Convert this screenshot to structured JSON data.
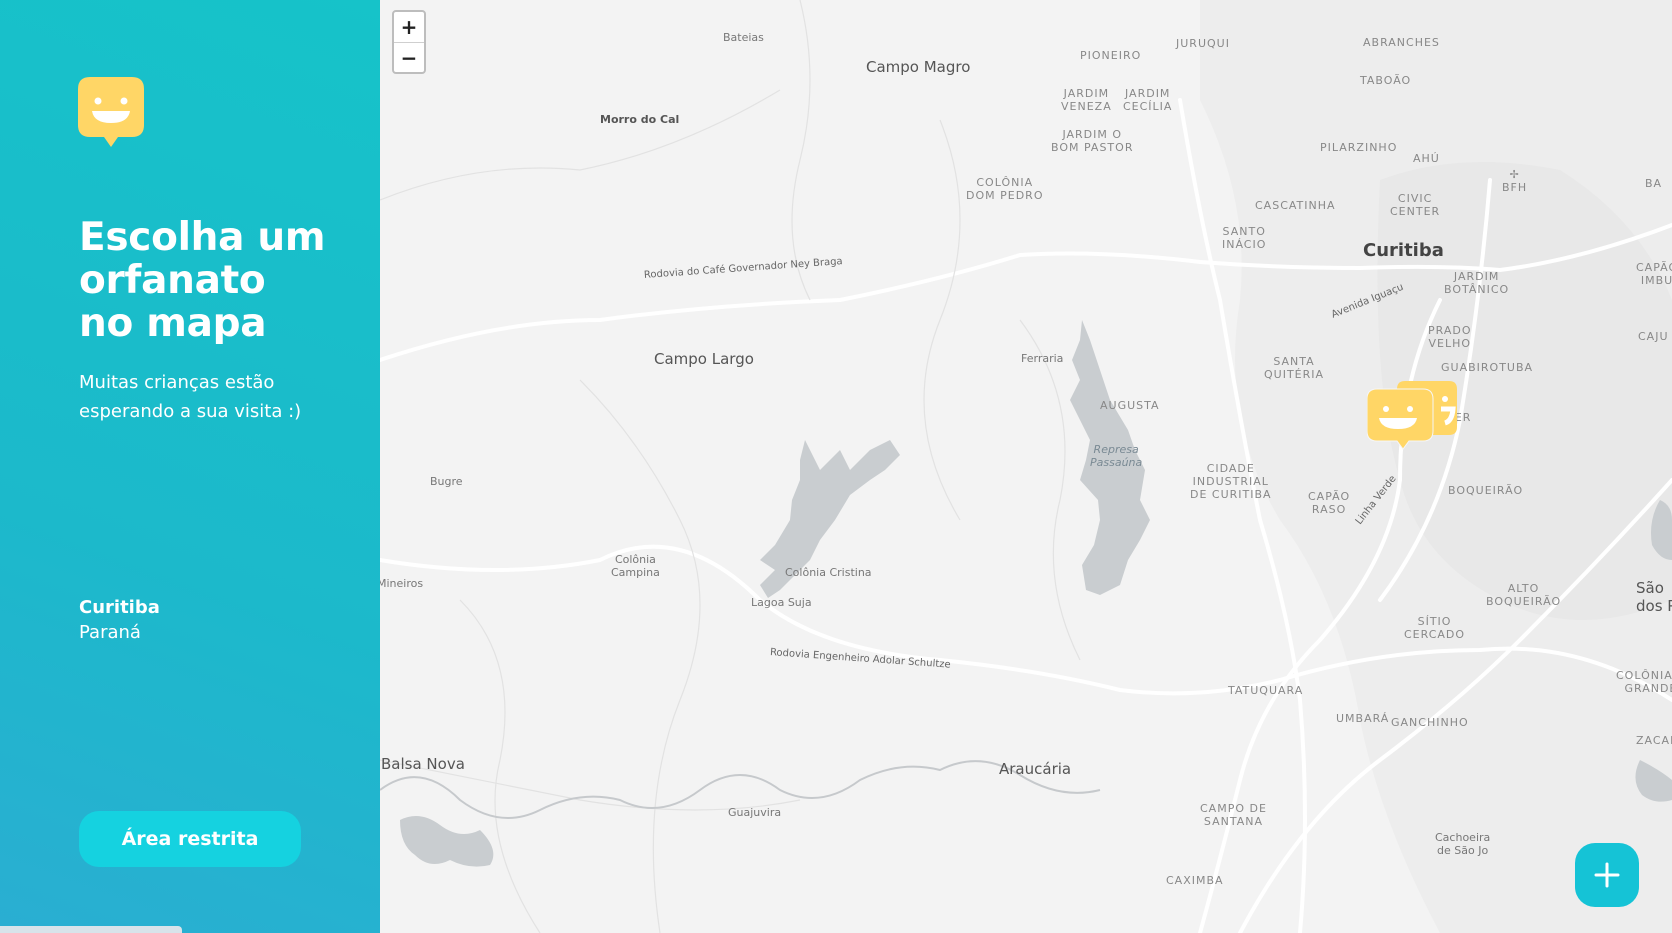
{
  "sidebar": {
    "title_line1": "Escolha um",
    "title_line2": "orfanato",
    "title_line3": "no mapa",
    "subtitle_line1": "Muitas crianças estão",
    "subtitle_line2": "esperando a sua visita :)",
    "location_city": "Curitiba",
    "location_state": "Paraná",
    "restricted_label": "Área restrita"
  },
  "map": {
    "zoom_in": "+",
    "zoom_out": "−",
    "add_button": "+",
    "labels": {
      "bateias": "Bateias",
      "campo_magro": "Campo Magro",
      "pioneiro": "PIONEIRO",
      "juruqui": "JURUQUI",
      "abranches": "ABRANCHES",
      "taboao": "TABOÃO",
      "jardim_veneza_1": "JARDIM",
      "jardim_veneza_2": "VENEZA",
      "jardim_cecilia_1": "JARDIM",
      "jardim_cecilia_2": "CECÍLIA",
      "jardim_bom_pastor_1": "JARDIM O",
      "jardim_bom_pastor_2": "BOM PASTOR",
      "morro_do_cal": "Morro do Cal",
      "pilarzinho": "PILARZINHO",
      "ahu": "AHÚ",
      "bfh": "BFH",
      "ba": "BA",
      "colonia_dom_pedro_1": "COLÔNIA",
      "colonia_dom_pedro_2": "DOM PEDRO",
      "cascatinha": "CASCATINHA",
      "civic_center_1": "CIVIC",
      "civic_center_2": "CENTER",
      "santo_inacio_1": "SANTO",
      "santo_inacio_2": "INÁCIO",
      "curitiba": "Curitiba",
      "jardim_botanico_1": "JARDIM",
      "jardim_botanico_2": "BOTÂNICO",
      "capao_imbuia_1": "CAPÃO",
      "capao_imbuia_2": "IMBU",
      "road_cafe": "Rodovia do Café Governador Ney Braga",
      "avenida_iguacu": "Avenida Iguaçu",
      "prado_velho_1": "PRADO",
      "prado_velho_2": "VELHO",
      "cajuru": "CAJU",
      "campo_largo": "Campo Largo",
      "ferraria": "Ferraria",
      "santa_quiteria_1": "SANTA",
      "santa_quiteria_2": "QUITÉRIA",
      "guabirotuba": "GUABIROTUBA",
      "augusta": "AUGUSTA",
      "hauer": "HAUER",
      "represa_1": "Represa",
      "represa_2": "Passaúna",
      "cidade_industrial_1": "CIDADE",
      "cidade_industrial_2": "INDUSTRIAL",
      "cidade_industrial_3": "DE CURITIBA",
      "bugre": "Bugre",
      "capao_raso_1": "CAPÃO",
      "capao_raso_2": "RASO",
      "linha_verde": "Linha Verde",
      "boqueirao": "BOQUEIRÃO",
      "colonia_campina_1": "Colônia",
      "colonia_campina_2": "Campina",
      "colonia_cristina": "Colônia Cristina",
      "mineiros": "Mineiros",
      "lagoa_suja": "Lagoa Suja",
      "alto_boqueirao_1": "ALTO",
      "alto_boqueirao_2": "BOQUEIRÃO",
      "sao_jose_1": "São",
      "sao_jose_2": "dos P",
      "sitio_cercado_1": "SÍTIO",
      "sitio_cercado_2": "CERCADO",
      "road_schultze": "Rodovia Engenheiro Adolar Schultze",
      "colonia_grande_1": "COLÔNIA R",
      "colonia_grande_2": "GRANDE",
      "tatuquara": "TATUQUARA",
      "umbara": "UMBARÁ",
      "ganchinho": "GANCHINHO",
      "zacarias": "ZACAR",
      "balsa_nova": "Balsa Nova",
      "araucaria": "Araucária",
      "guajuvira": "Guajuvira",
      "campo_santana_1": "CAMPO DE",
      "campo_santana_2": "SANTANA",
      "cachoeira_1": "Cachoeira",
      "cachoeira_2": "de São Jo",
      "caximba": "CAXIMBA"
    }
  },
  "colors": {
    "sidebar_start": "#16c3c9",
    "sidebar_end": "#2aaed2",
    "button": "#15d2e0",
    "marker": "#ffd666",
    "water": "#c9cdd0",
    "map_bg": "#f3f3f3"
  },
  "icons": {
    "logo": "happy-face-pin-icon",
    "marker": "happy-face-pin-icon",
    "add": "plus-icon"
  }
}
